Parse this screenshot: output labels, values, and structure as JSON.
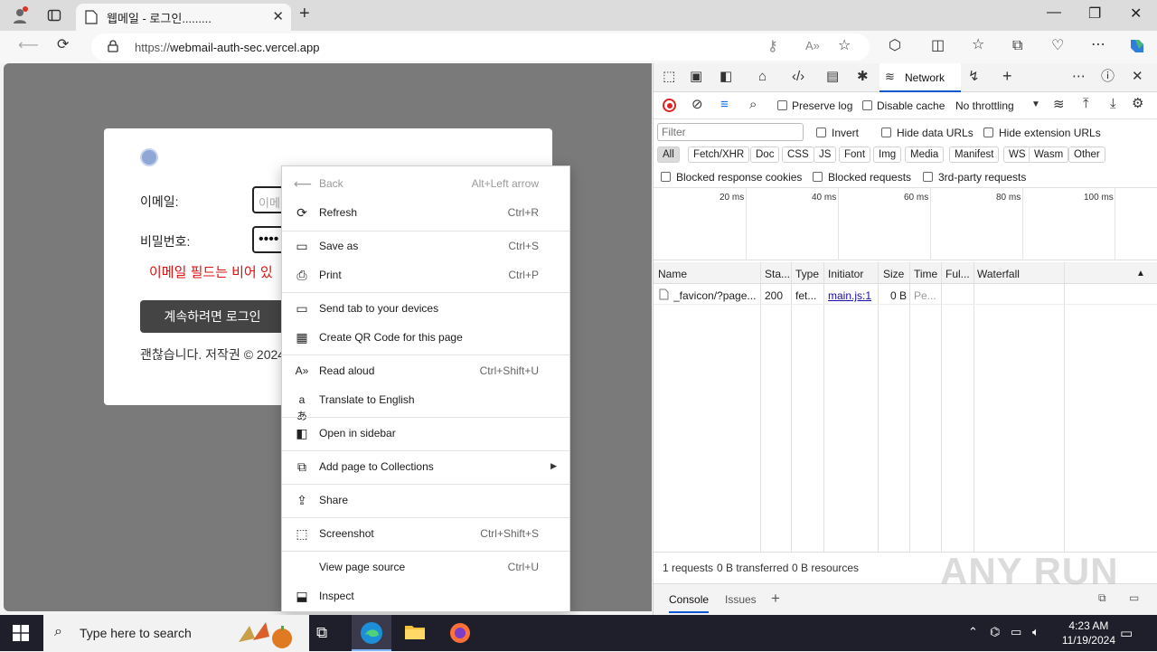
{
  "browser": {
    "tab_title": "웹메일 - 로그인.........",
    "url_prefix": "https://",
    "url_host": "webmail-auth-sec.vercel.app"
  },
  "page": {
    "email_label": "이메일:",
    "email_placeholder": "이메",
    "password_label": "비밀번호:",
    "password_value": "••••",
    "error_text": "이메일 필드는 비어 있",
    "login_button": "계속하려면 로그인",
    "copyright": "괜찮습니다. 저작권 © 2024"
  },
  "context_menu": {
    "items": [
      {
        "label": "Back",
        "shortcut": "Alt+Left arrow",
        "icon": "arrow-left-icon",
        "disabled": true
      },
      {
        "label": "Refresh",
        "shortcut": "Ctrl+R",
        "icon": "refresh-icon"
      },
      {
        "label": "Save as",
        "shortcut": "Ctrl+S",
        "icon": "save-icon"
      },
      {
        "label": "Print",
        "shortcut": "Ctrl+P",
        "icon": "print-icon"
      },
      {
        "label": "Send tab to your devices",
        "shortcut": "",
        "icon": "devices-icon"
      },
      {
        "label": "Create QR Code for this page",
        "shortcut": "",
        "icon": "qr-code-icon"
      },
      {
        "label": "Read aloud",
        "shortcut": "Ctrl+Shift+U",
        "icon": "read-aloud-icon"
      },
      {
        "label": "Translate to English",
        "shortcut": "",
        "icon": "translate-icon"
      },
      {
        "label": "Open in sidebar",
        "shortcut": "",
        "icon": "sidebar-icon"
      },
      {
        "label": "Add page to Collections",
        "shortcut": "",
        "icon": "collections-icon"
      },
      {
        "label": "Share",
        "shortcut": "",
        "icon": "share-icon"
      },
      {
        "label": "Screenshot",
        "shortcut": "Ctrl+Shift+S",
        "icon": "screenshot-icon"
      },
      {
        "label": "View page source",
        "shortcut": "Ctrl+U",
        "icon": ""
      },
      {
        "label": "Inspect",
        "shortcut": "",
        "icon": "inspect-icon"
      }
    ]
  },
  "devtools": {
    "active_tab": "Network",
    "preserve_log": "Preserve log",
    "disable_cache": "Disable cache",
    "throttling": "No throttling",
    "filter_placeholder": "Filter",
    "invert": "Invert",
    "hide_data_urls": "Hide data URLs",
    "hide_extension_urls": "Hide extension URLs",
    "type_filters": [
      "All",
      "Fetch/XHR",
      "Doc",
      "CSS",
      "JS",
      "Font",
      "Img",
      "Media",
      "Manifest",
      "WS",
      "Wasm",
      "Other"
    ],
    "blocked_response_cookies": "Blocked response cookies",
    "blocked_requests": "Blocked requests",
    "third_party_requests": "3rd-party requests",
    "timeline_ticks": [
      "20 ms",
      "40 ms",
      "60 ms",
      "80 ms",
      "100 ms"
    ],
    "columns": [
      "Name",
      "Sta...",
      "Type",
      "Initiator",
      "Size",
      "Time",
      "Ful...",
      "Waterfall"
    ],
    "rows": [
      {
        "name": "_favicon/?page...",
        "status": "200",
        "type": "fet...",
        "initiator": "main.js:1",
        "size": "0 B",
        "time": "Pe..."
      }
    ],
    "summary": {
      "requests": "1 requests",
      "transferred": "0 B transferred",
      "resources": "0 B resources"
    },
    "drawer_tabs": [
      "Console",
      "Issues"
    ]
  },
  "taskbar": {
    "search_placeholder": "Type here to search",
    "time": "4:23 AM",
    "date": "11/19/2024"
  },
  "watermark": "ANY RUN"
}
